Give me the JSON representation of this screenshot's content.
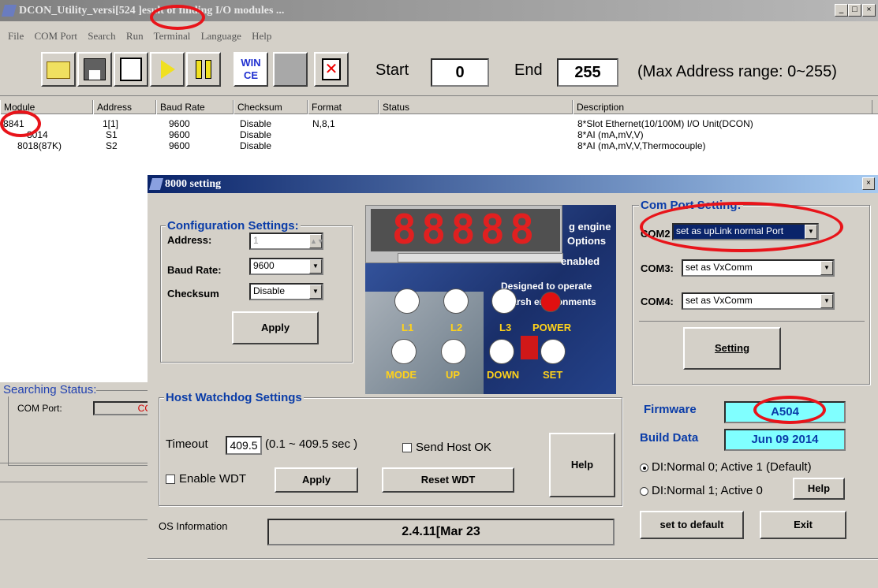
{
  "main": {
    "title_parts": [
      "DCON_Utility_versi",
      "[524 ]",
      "esult of finding I/O modules ..."
    ],
    "menu": [
      "File",
      "COM Port",
      "Search",
      "Run",
      "Terminal",
      "Language",
      "Help"
    ],
    "toolbar": {
      "start_label": "Start",
      "start_value": "0",
      "end_label": "End",
      "end_value": "255",
      "range_note": "(Max Address range: 0~255)",
      "win_ce": "WIN CE"
    },
    "columns": [
      "Module",
      "Address",
      "Baud Rate",
      "Checksum",
      "Format",
      "Status",
      "Description"
    ],
    "rows": [
      {
        "module": "8841",
        "address": "1[1]",
        "baud": "9600",
        "checksum": "Disable",
        "format": "N,8,1",
        "status": "",
        "description": "8*Slot Ethernet(10/100M) I/O Unit(DCON)"
      },
      {
        "module": "8014",
        "address": "S1",
        "baud": "9600",
        "checksum": "Disable",
        "format": "",
        "status": "",
        "description": "8*AI (mA,mV,V)"
      },
      {
        "module": "8018(87K)",
        "address": "S2",
        "baud": "9600",
        "checksum": "Disable",
        "format": "",
        "status": "",
        "description": "8*AI (mA,mV,V,Thermocouple)"
      }
    ],
    "search_status": {
      "title": "Searching Status:",
      "com_label": "COM Port:",
      "com_value": "CC"
    }
  },
  "dialog": {
    "title": "8000 setting",
    "config": {
      "title": "Configuration Settings:",
      "address_label": "Address:",
      "address_value": "1",
      "baud_label": "Baud Rate:",
      "baud_value": "9600",
      "checksum_label": "Checksum",
      "checksum_value": "Disable",
      "apply": "Apply"
    },
    "panel": {
      "overlay": [
        "g engine",
        "Options",
        "enabled",
        "Designed to operate",
        "in harsh environments"
      ],
      "leds_top": [
        "L1",
        "L2",
        "L3",
        "POWER"
      ],
      "leds_bottom": [
        "MODE",
        "UP",
        "DOWN",
        "SET"
      ]
    },
    "comport": {
      "title": "Com Port Setting:",
      "com2_label": "COM2",
      "com2_value": "set as upLink normal Port",
      "com3_label": "COM3:",
      "com3_value": "set as VxComm",
      "com4_label": "COM4:",
      "com4_value": "set as VxComm",
      "setting": "Setting"
    },
    "watchdog": {
      "title": "Host Watchdog Settings",
      "timeout_label": "Timeout",
      "timeout_value": "409.5",
      "range": "(0.1 ~ 409.5 sec )",
      "send_host_ok": "Send Host OK",
      "enable_wdt": "Enable WDT",
      "apply": "Apply",
      "reset": "Reset WDT",
      "help": "Help"
    },
    "firmware_label": "Firmware",
    "firmware_value": "A504",
    "build_label": "Build Data",
    "build_value": "Jun 09 2014",
    "radio1": "DI:Normal 0;  Active 1 (Default)",
    "radio2": "DI:Normal 1;  Active 0",
    "help": "Help",
    "os_label": "OS Information",
    "os_value": "2.4.11[Mar 23",
    "set_default": "set to default",
    "exit": "Exit"
  },
  "colors": {
    "accent_red": "#e8141a",
    "title_blue": "#0a246a",
    "group_blue": "#0a3ca8",
    "firmware_bg": "#80ffff"
  }
}
